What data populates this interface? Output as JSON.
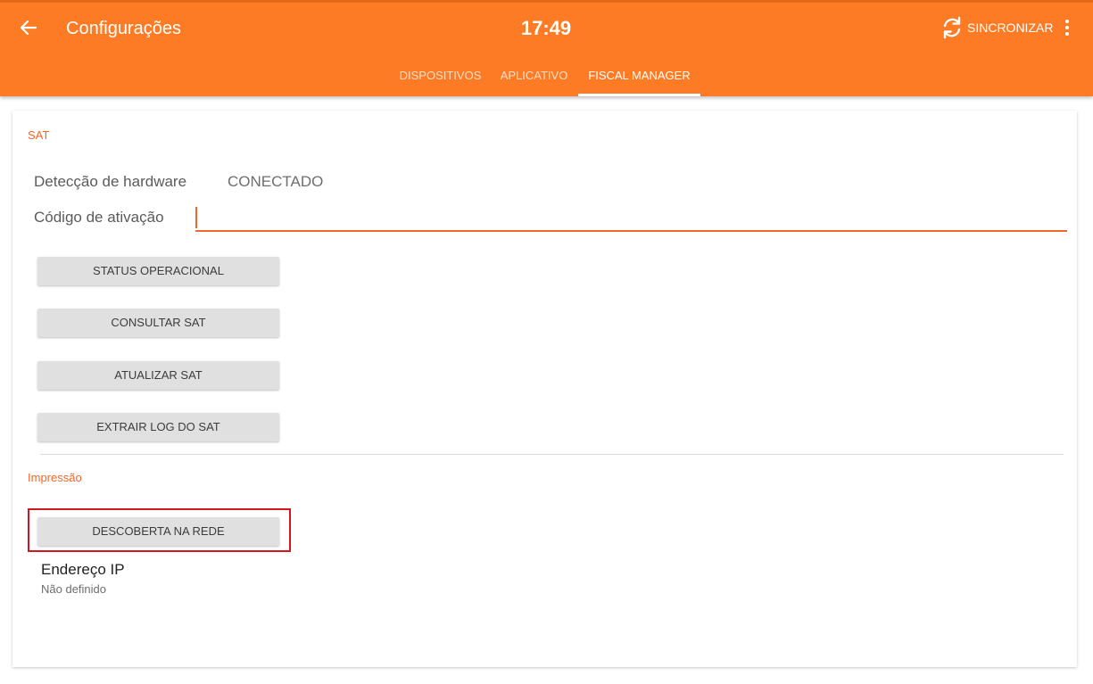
{
  "header": {
    "title": "Configurações",
    "time": "17:49",
    "sync_label": "SINCRONIZAR",
    "back_icon": "arrow-left-icon",
    "sync_icon": "sync-icon",
    "more_icon": "more-vert-icon",
    "bg_color": "#fc7b24"
  },
  "tabs": [
    {
      "label": "DISPOSITIVOS",
      "active": false
    },
    {
      "label": "APLICATIVO",
      "active": false
    },
    {
      "label": "FISCAL MANAGER",
      "active": true
    }
  ],
  "sat": {
    "section_title": "SAT",
    "hardware_label": "Detecção de hardware",
    "hardware_value": "CONECTADO",
    "activation_label": "Código de ativação",
    "activation_value": "",
    "buttons": [
      "STATUS OPERACIONAL",
      "CONSULTAR SAT",
      "ATUALIZAR SAT",
      "EXTRAIR LOG DO SAT"
    ]
  },
  "printing": {
    "section_title": "Impressão",
    "discover_button": "DESCOBERTA NA REDE",
    "ip_title": "Endereço IP",
    "ip_value": "Não definido"
  },
  "colors": {
    "accent": "#f0672a",
    "highlight": "#d3161f"
  }
}
